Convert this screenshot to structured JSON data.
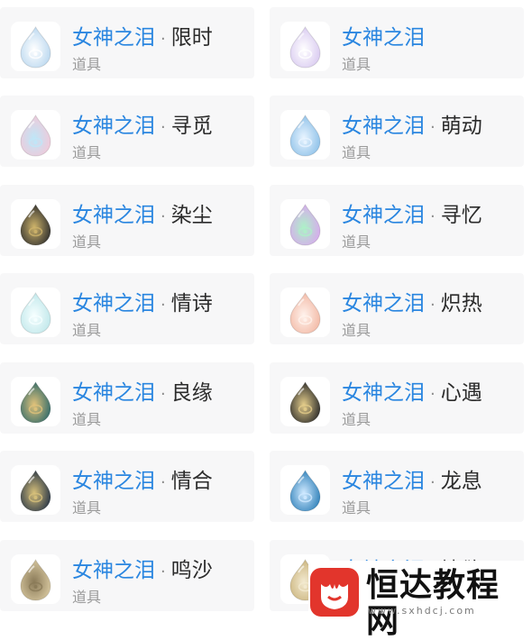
{
  "items": [
    {
      "name": "女神之泪",
      "suffix": "限时",
      "sub": "道具",
      "icon": "ice-teardrop-icon",
      "color": "#b9d7ef",
      "accent": "#ffffff"
    },
    {
      "name": "女神之泪",
      "suffix": "",
      "sub": "道具",
      "icon": "lavender-teardrop-icon",
      "color": "#d8c9f0",
      "accent": "#ffffff"
    },
    {
      "name": "女神之泪",
      "suffix": "寻觅",
      "sub": "道具",
      "icon": "pastel-teardrop-icon",
      "color": "#f3c8d8",
      "accent": "#bfe6f7"
    },
    {
      "name": "女神之泪",
      "suffix": "萌动",
      "sub": "道具",
      "icon": "blue-teardrop-icon",
      "color": "#8cc0e8",
      "accent": "#e8f4ff"
    },
    {
      "name": "女神之泪",
      "suffix": "染尘",
      "sub": "道具",
      "icon": "dark-eye-teardrop-icon",
      "color": "#2e2e2e",
      "accent": "#cdb36a"
    },
    {
      "name": "女神之泪",
      "suffix": "寻忆",
      "sub": "道具",
      "icon": "rainbow-teardrop-icon",
      "color": "#d9a8ef",
      "accent": "#aef0c8"
    },
    {
      "name": "女神之泪",
      "suffix": "情诗",
      "sub": "道具",
      "icon": "crystal-teardrop-icon",
      "color": "#bfe7ea",
      "accent": "#f6ffff"
    },
    {
      "name": "女神之泪",
      "suffix": "炽热",
      "sub": "道具",
      "icon": "peach-teardrop-icon",
      "color": "#f2b8a4",
      "accent": "#fff2ec"
    },
    {
      "name": "女神之泪",
      "suffix": "良缘",
      "sub": "道具",
      "icon": "teal-teardrop-icon",
      "color": "#2f6a6a",
      "accent": "#e0c27a"
    },
    {
      "name": "女神之泪",
      "suffix": "心遇",
      "sub": "道具",
      "icon": "black-gold-teardrop-icon",
      "color": "#2a2a2a",
      "accent": "#e3cc8a"
    },
    {
      "name": "女神之泪",
      "suffix": "情合",
      "sub": "道具",
      "icon": "navy-teardrop-icon",
      "color": "#263446",
      "accent": "#d7c07a"
    },
    {
      "name": "女神之泪",
      "suffix": "龙息",
      "sub": "道具",
      "icon": "sapphire-teardrop-icon",
      "color": "#2d7fb8",
      "accent": "#cfe9ff"
    },
    {
      "name": "女神之泪",
      "suffix": "鸣沙",
      "sub": "道具",
      "icon": "sand-teardrop-icon",
      "color": "#d8c8a0",
      "accent": "#8a7a58"
    },
    {
      "name": "女神之泪",
      "suffix": "情欲",
      "sub": "道具",
      "icon": "gold-teardrop-icon",
      "color": "#c9b27a",
      "accent": "#f3ead0"
    }
  ],
  "watermark": {
    "text": "恒达教程网",
    "url": "www.sxhdcj.com",
    "logo": "heart-hand-logo-icon",
    "logo_color": "#e2352c"
  }
}
